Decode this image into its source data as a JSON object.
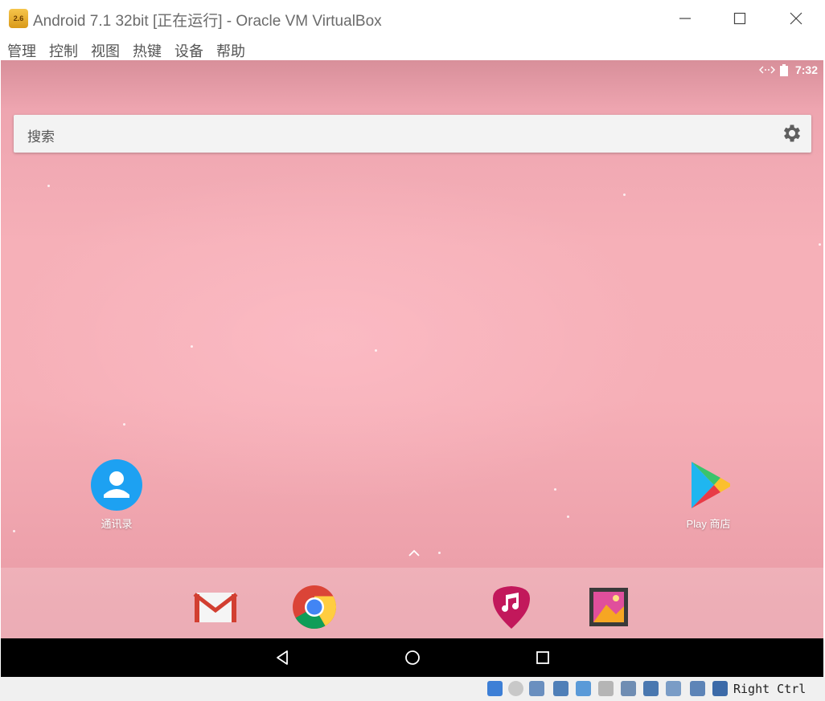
{
  "window": {
    "title": "Android 7.1 32bit [正在运行] - Oracle VM VirtualBox",
    "icon_label": "2.6",
    "controls": [
      "minimize-icon",
      "maximize-icon",
      "close-icon"
    ]
  },
  "menu": [
    "管理",
    "控制",
    "视图",
    "热键",
    "设备",
    "帮助"
  ],
  "android": {
    "status": {
      "time": "7:32",
      "icons": [
        "data-sync-icon",
        "battery-icon"
      ]
    },
    "search": {
      "placeholder": "搜索",
      "settings_icon": "gear-icon"
    },
    "home_apps": [
      {
        "label": "通讯录",
        "icon": "contacts-icon"
      },
      {
        "label": "Play 商店",
        "icon": "play-store-icon"
      }
    ],
    "dock": [
      "gmail-icon",
      "chrome-icon",
      "music-icon",
      "gallery-icon"
    ],
    "nav": [
      "back-icon",
      "home-icon",
      "recents-icon"
    ],
    "colors": {
      "wallpaper": "#f6b0b8",
      "navbar": "#000000",
      "search_bg": "#f3f3f3",
      "contacts": "#1da1f2"
    }
  },
  "vbox_status": {
    "host_key": "Right Ctrl",
    "icons": [
      "hard-disk-icon",
      "optical-disk-icon",
      "audio-icon",
      "network-icon",
      "usb-icon",
      "shared-folder-icon",
      "display-icon",
      "video-capture-icon",
      "cpu-icon",
      "mouse-integration-icon",
      "keyboard-capture-icon"
    ]
  }
}
